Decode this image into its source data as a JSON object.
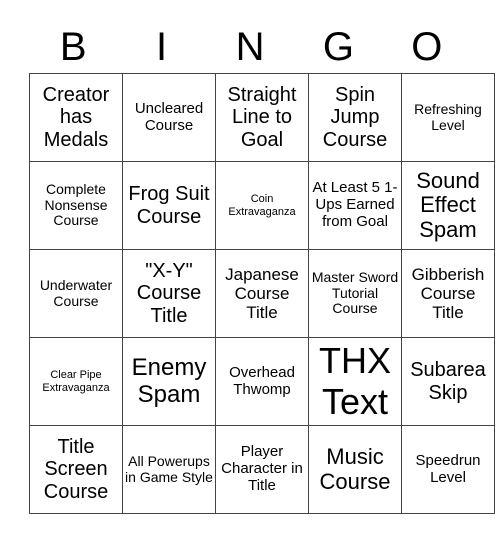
{
  "header": {
    "letters": [
      "B",
      "I",
      "N",
      "G",
      "O"
    ]
  },
  "grid": {
    "rows": [
      [
        "Creator has Medals",
        "Uncleared Course",
        "Straight Line to Goal",
        "Spin Jump Course",
        "Refreshing Level"
      ],
      [
        "Complete Nonsense Course",
        "Frog Suit Course",
        "Coin Extravaganza",
        "At Least 5 1-Ups Earned from Goal",
        "Sound Effect Spam"
      ],
      [
        "Underwater Course",
        "\"X-Y\" Course Title",
        "Japanese Course Title",
        "Master Sword Tutorial Course",
        "Gibberish Course Title"
      ],
      [
        "Clear Pipe Extravaganza",
        "Enemy Spam",
        "Overhead Thwomp",
        "THX Text",
        "Subarea Skip"
      ],
      [
        "Title Screen Course",
        "All Powerups in Game Style",
        "Player Character in Title",
        "Music Course",
        "Speedrun Level"
      ]
    ]
  }
}
